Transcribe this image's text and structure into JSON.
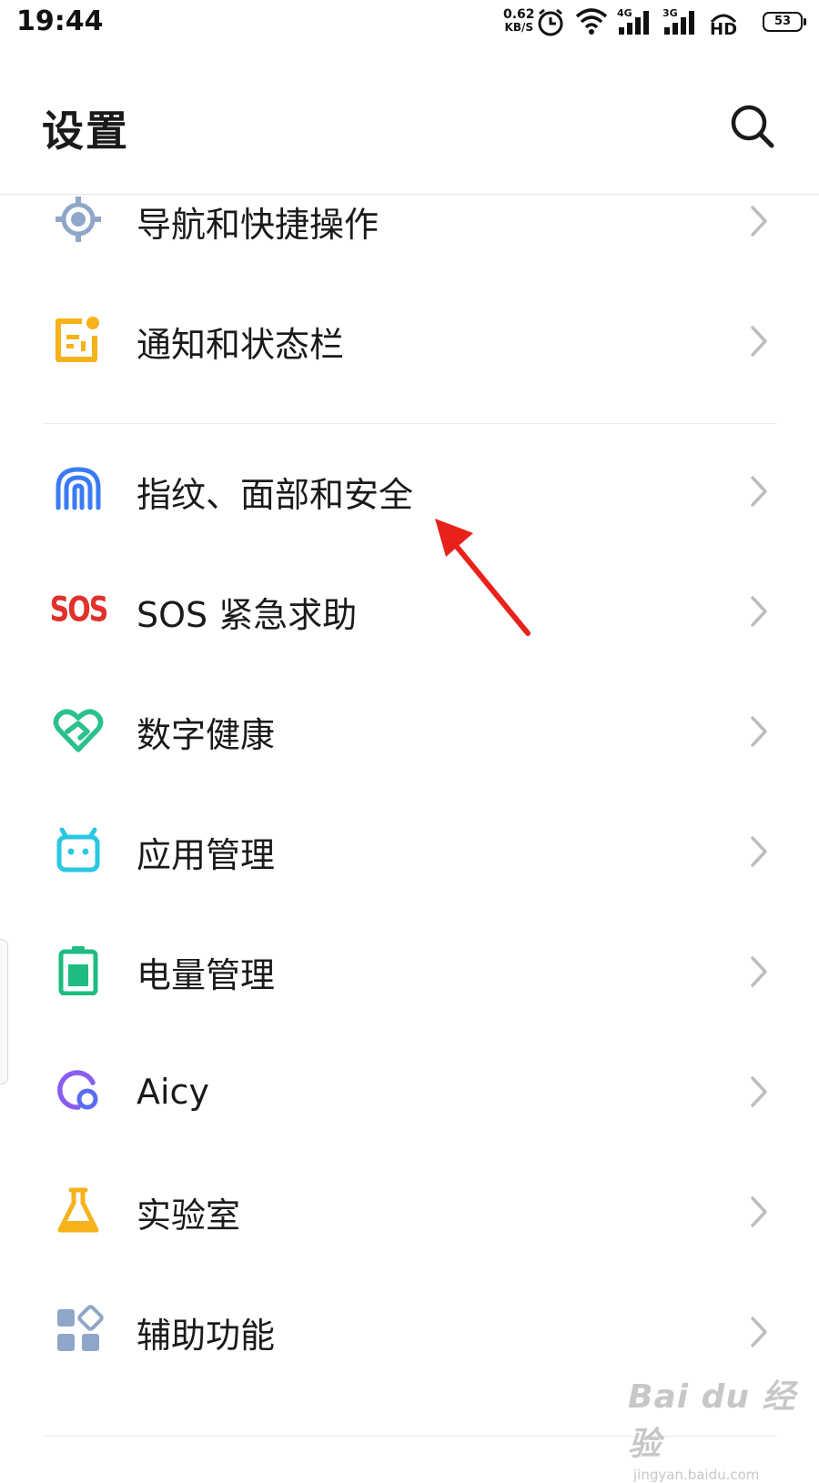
{
  "status_bar": {
    "time": "19:44",
    "net_speed": "0.62",
    "net_unit": "KB/S",
    "signal1_label": "4G",
    "signal2_label": "3G",
    "hd_label": "HD",
    "battery": "53"
  },
  "header": {
    "title": "设置",
    "search_icon": "search-icon"
  },
  "settings_items": [
    {
      "label": "导航和快捷操作",
      "icon": "navigation-icon",
      "color": "#8fa6c8"
    },
    {
      "label": "通知和状态栏",
      "icon": "notification-icon",
      "color": "#f5b21b"
    },
    {
      "label": "指纹、面部和安全",
      "icon": "fingerprint-icon",
      "color": "#3a7bf2"
    },
    {
      "label": "SOS 紧急求助",
      "icon": "sos-icon",
      "color": "#e0312b"
    },
    {
      "label": "数字健康",
      "icon": "digital-wellbeing-icon",
      "color": "#2bc08f"
    },
    {
      "label": "应用管理",
      "icon": "app-management-icon",
      "color": "#28c8e0"
    },
    {
      "label": "电量管理",
      "icon": "battery-management-icon",
      "color": "#1ebc80"
    },
    {
      "label": "Aicy",
      "icon": "aicy-icon",
      "color": "#8a5cf2"
    },
    {
      "label": "实验室",
      "icon": "lab-flask-icon",
      "color": "#f5b21b"
    },
    {
      "label": "辅助功能",
      "icon": "accessibility-icon",
      "color": "#8fa6c8"
    }
  ],
  "sos_icon_text": "SOS",
  "watermark": {
    "main": "Bai du 经验",
    "sub": "jingyan.baidu.com"
  }
}
